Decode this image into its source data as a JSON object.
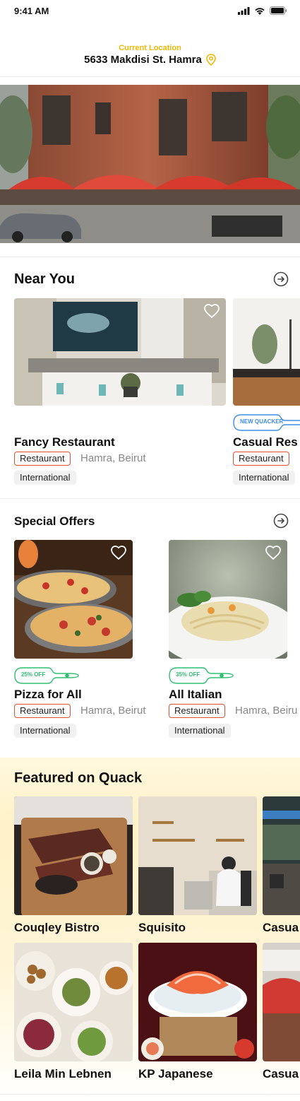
{
  "status": {
    "time": "9:41 AM"
  },
  "location": {
    "caption": "Current Location",
    "address": "5633 Makdisi St. Hamra"
  },
  "near_you": {
    "title": "Near You",
    "cards": [
      {
        "name": "Fancy Restaurant",
        "type": "Restaurant",
        "location": "Hamra, Beirut",
        "cuisine": "International"
      },
      {
        "name": "Casual Res",
        "badge": "NEW QUACKER",
        "type": "Restaurant",
        "cuisine": "International"
      }
    ]
  },
  "special_offers": {
    "title": "Special Offers",
    "cards": [
      {
        "name": "Pizza for All",
        "badge": "25% OFF",
        "type": "Restaurant",
        "location": "Hamra, Beirut",
        "cuisine": "International"
      },
      {
        "name": "All Italian",
        "badge": "35% OFF",
        "type": "Restaurant",
        "location": "Hamra, Beiru",
        "cuisine": "International"
      }
    ]
  },
  "featured": {
    "title": "Featured on Quack",
    "items": [
      {
        "name": "Couqley Bistro"
      },
      {
        "name": "Squisito"
      },
      {
        "name": "Casua"
      },
      {
        "name": "Leila Min Lebnen"
      },
      {
        "name": "KP Japanese"
      },
      {
        "name": "Casua"
      }
    ]
  },
  "colors": {
    "accent_yellow": "#f2b705",
    "tag_red": "#e0502f",
    "badge_blue": "#3f8ee8",
    "badge_green": "#2fbf71"
  }
}
